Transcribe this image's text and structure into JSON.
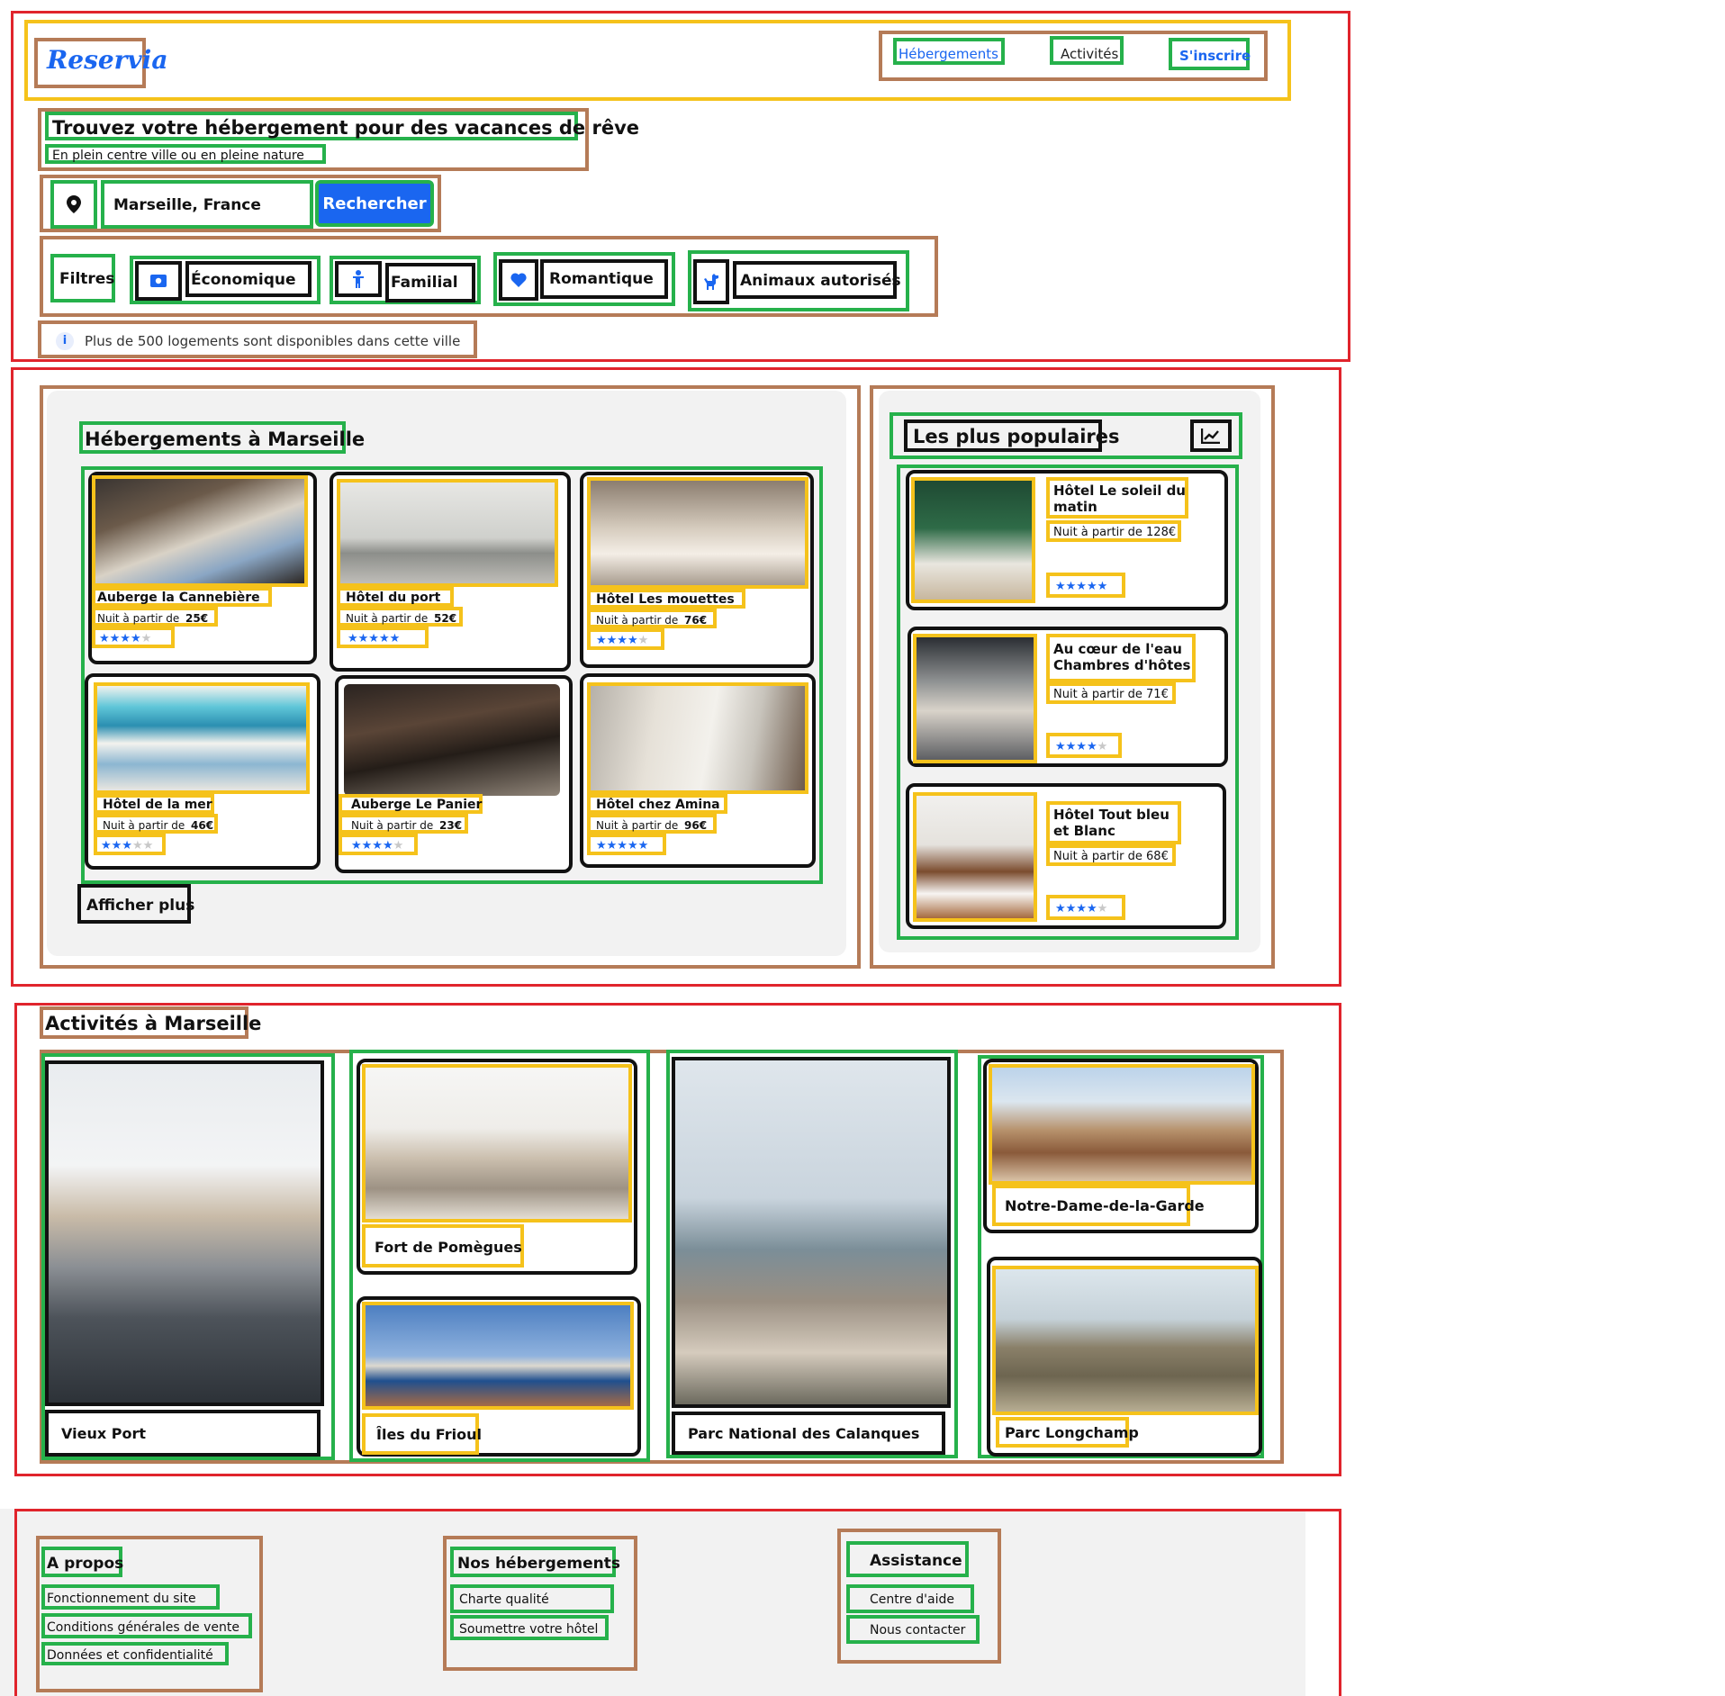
{
  "brand": {
    "logo": "Reservia"
  },
  "nav": {
    "items": [
      {
        "label": "Hébergements"
      },
      {
        "label": "Activités"
      },
      {
        "label": "S'inscrire"
      }
    ]
  },
  "hero": {
    "title": "Trouvez votre hébergement pour des vacances de rêve",
    "subtitle": "En plein centre ville ou en pleine nature"
  },
  "search": {
    "location": "Marseille, France",
    "button": "Rechercher"
  },
  "filters": {
    "label": "Filtres",
    "items": [
      {
        "label": "Économique",
        "icon": "money-icon"
      },
      {
        "label": "Familial",
        "icon": "child-icon"
      },
      {
        "label": "Romantique",
        "icon": "heart-icon"
      },
      {
        "label": "Animaux autorisés",
        "icon": "dog-icon"
      }
    ]
  },
  "info": {
    "text": "Plus de 500 logements sont disponibles dans cette ville"
  },
  "accommodations": {
    "title": "Hébergements à Marseille",
    "price_prefix": "Nuit à partir de",
    "items": [
      {
        "name": "Auberge la Cannebière",
        "price": "25€",
        "rating": 4
      },
      {
        "name": "Hôtel du port",
        "price": "52€",
        "rating": 5
      },
      {
        "name": "Hôtel Les mouettes",
        "price": "76€",
        "rating": 4
      },
      {
        "name": "Hôtel de la mer",
        "price": "46€",
        "rating": 3
      },
      {
        "name": "Auberge Le Panier",
        "price": "23€",
        "rating": 4
      },
      {
        "name": "Hôtel chez Amina",
        "price": "96€",
        "rating": 5
      }
    ],
    "more": "Afficher plus"
  },
  "popular": {
    "title": "Les plus populaires",
    "icon": "trend-chart-icon",
    "items": [
      {
        "name": "Hôtel Le soleil du matin",
        "price": "Nuit à partir de 128€",
        "rating": 5
      },
      {
        "name": "Au cœur de l'eau Chambres d'hôtes",
        "price": "Nuit à partir de 71€",
        "rating": 4
      },
      {
        "name": "Hôtel Tout bleu et Blanc",
        "price": "Nuit à partir de 68€",
        "rating": 4
      }
    ]
  },
  "activities": {
    "title": "Activités à Marseille",
    "items": [
      {
        "name": "Vieux Port"
      },
      {
        "name": "Fort de Pomègues"
      },
      {
        "name": "Îles du Frioul"
      },
      {
        "name": "Parc National des Calanques"
      },
      {
        "name": "Notre-Dame-de-la-Garde"
      },
      {
        "name": "Parc Longchamp"
      }
    ]
  },
  "footer": {
    "columns": [
      {
        "title": "A propos",
        "links": [
          "Fonctionnement du site",
          "Conditions générales de vente",
          "Données et confidentialité"
        ]
      },
      {
        "title": "Nos hébergements",
        "links": [
          "Charte qualité",
          "Soumettre votre hôtel"
        ]
      },
      {
        "title": "Assistance",
        "links": [
          "Centre d'aide",
          "Nous contacter"
        ]
      }
    ]
  },
  "colors": {
    "accent": "#1a66f0",
    "panel": "#f2f2f2"
  }
}
